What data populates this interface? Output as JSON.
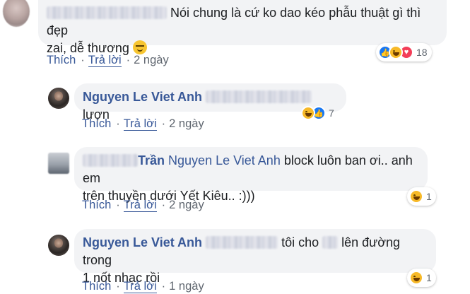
{
  "actions": {
    "like": "Thích",
    "reply": "Trả lời",
    "separator": "·"
  },
  "comments": [
    {
      "author": "",
      "text": "Nói chung là cứ ko dao kéo phẫu thuật gì thì đẹp",
      "text2": "zai, dễ thương",
      "time": "2 ngày",
      "reactions": {
        "icons": [
          "like-icon",
          "haha-icon",
          "love-icon"
        ],
        "count": "18"
      }
    },
    {
      "author": "Nguyen Le Viet Anh",
      "text": "lượn",
      "time": "2 ngày",
      "reactions": {
        "icons": [
          "haha-icon",
          "like-icon"
        ],
        "count": "7"
      }
    },
    {
      "author": "Trần",
      "mention": "Nguyen Le Viet Anh",
      "text": "block luôn ban ơi.. anh em",
      "text2": "trên thuyền dưới Yết Kiêu.. :)))",
      "time": "2 ngày",
      "reactions": {
        "icons": [
          "haha-icon"
        ],
        "count": "1"
      }
    },
    {
      "author": "Nguyen Le Viet Anh",
      "text": "tôi cho",
      "text_mid": "lên đường trong",
      "text2": "1 nốt nhạc rồi",
      "time": "1 ngày",
      "reactions": {
        "icons": [
          "haha-icon"
        ],
        "count": "1"
      }
    }
  ],
  "colors": {
    "link": "#385898",
    "bubble": "#f2f3f5",
    "meta": "#606770",
    "like": "#1877f2",
    "haha": "#f7b928",
    "love": "#f33e58"
  }
}
